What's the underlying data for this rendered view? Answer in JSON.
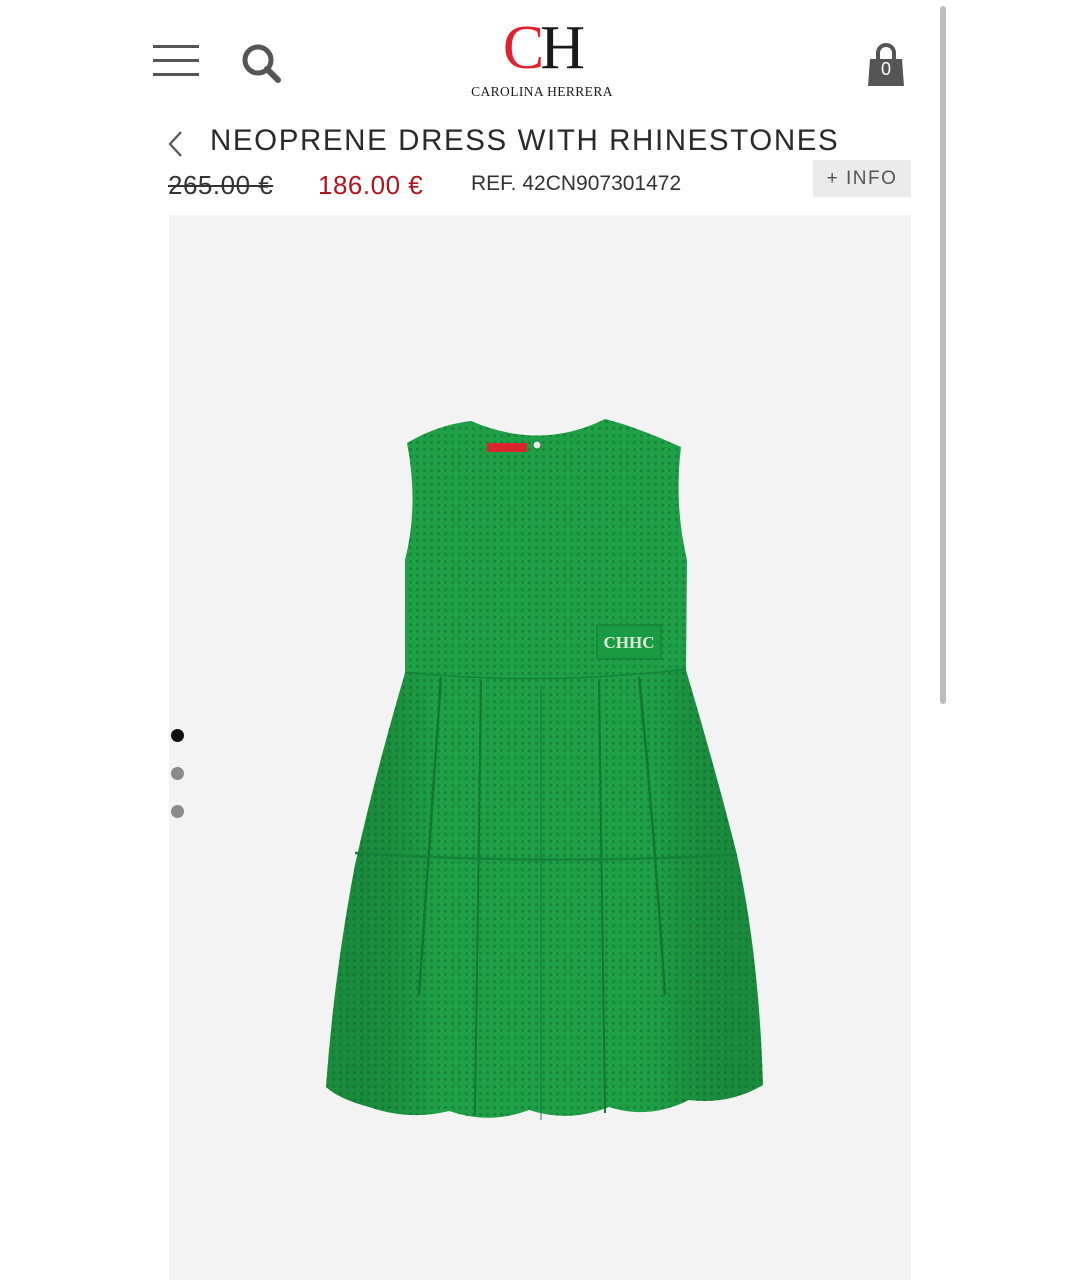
{
  "header": {
    "logo_letter_c": "C",
    "logo_letter_h": "H",
    "logo_text": "CAROLINA HERRERA",
    "bag_count": "0",
    "icons": [
      "menu-icon",
      "search-icon",
      "shopping-bag-icon"
    ]
  },
  "product": {
    "title": "NEOPRENE DRESS WITH RHINESTONES",
    "old_price": "265.00 €",
    "new_price": "186.00 €",
    "reference": "REF. 42CN907301472",
    "info_button": "+ INFO"
  },
  "gallery": {
    "image_count": 3,
    "active_index": 0,
    "dress_plaque_text": "CHHC"
  },
  "colors": {
    "brand_red": "#e2202e",
    "sale_red": "#b3131b",
    "dress_green": "#1fa046",
    "image_bg": "#f3f3f3"
  }
}
